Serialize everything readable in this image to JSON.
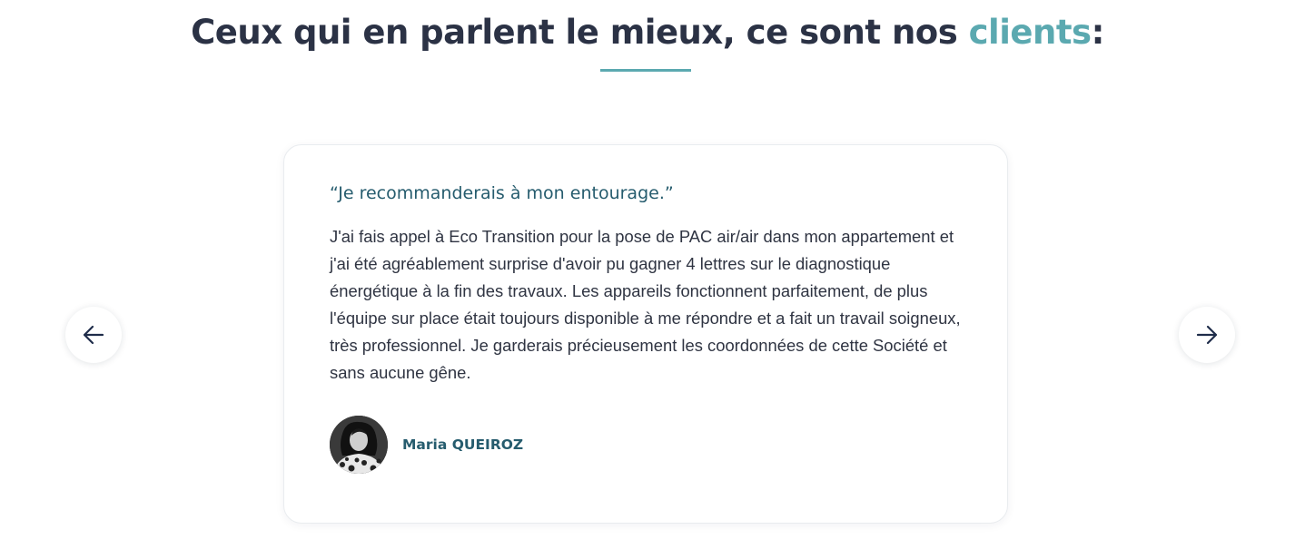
{
  "heading": {
    "text_before": "Ceux qui en parlent le mieux, ce sont nos ",
    "accent_word": "clients",
    "text_after": ":"
  },
  "testimonial": {
    "quote_title": "“Je recommanderais à mon entourage.”",
    "body": "J'ai fais appel à Eco Transition pour la pose de PAC air/air dans mon appartement et j'ai été agréablement surprise d'avoir pu gagner 4 lettres sur le diagnostique énergétique à la fin des travaux. Les appareils fonctionnent parfaitement, de plus l'équipe sur place était toujours disponible à me répondre et a fait un travail soigneux, très professionnel. Je garderais précieusement les coordonnées de cette Société et sans aucune gêne.",
    "author_name": "Maria QUEIROZ"
  },
  "navigation": {
    "prev_icon": "arrow-left-icon",
    "next_icon": "arrow-right-icon"
  },
  "colors": {
    "heading": "#2b3245",
    "accent": "#5ba9b0",
    "quote_title": "#265c6e",
    "body_text": "#2f3442"
  }
}
